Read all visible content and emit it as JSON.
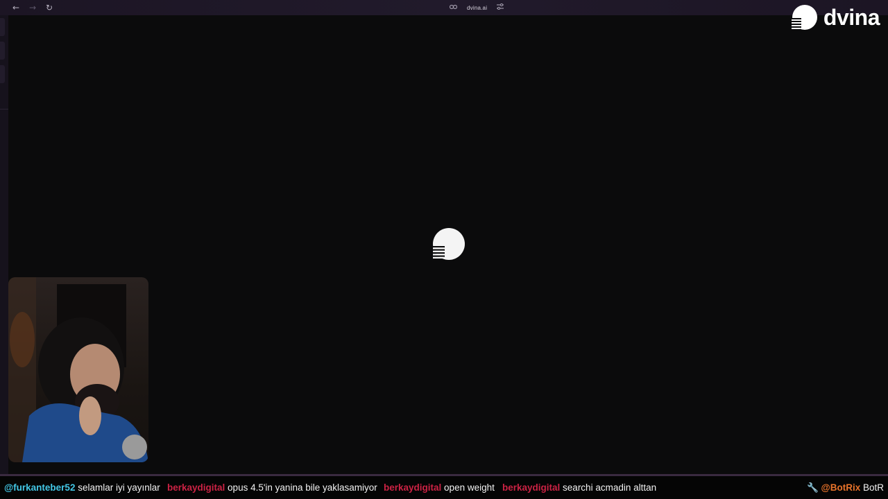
{
  "browser": {
    "url": "dvina.ai",
    "icons": {
      "back": "back-arrow-icon",
      "forward": "forward-arrow-icon",
      "reload": "reload-icon",
      "link": "link-icon",
      "settings": "sliders-icon"
    }
  },
  "brand": {
    "name": "dvina",
    "logo": "dvina-logo-icon"
  },
  "loader": {
    "icon": "dvina-loading-icon"
  },
  "webcam": {
    "label": "streamer-webcam"
  },
  "chat": {
    "messages": [
      {
        "user": "@furkanteber52",
        "text": "selamlar iyi yayınlar",
        "color": "#43c7e6"
      },
      {
        "user": "berkaydigital",
        "text": "opus 4.5'in yanina bile yaklasamiyor",
        "color": "#cc2244"
      },
      {
        "user": "berkaydigital",
        "text": "open weight",
        "color": "#cc2244"
      },
      {
        "user": "berkaydigital",
        "text": "searchi acmadin alttan",
        "color": "#cc2244"
      }
    ],
    "bot": {
      "icon": "wrench-icon",
      "user": "@BotRix",
      "text": "BotR",
      "color": "#e8732a"
    }
  }
}
